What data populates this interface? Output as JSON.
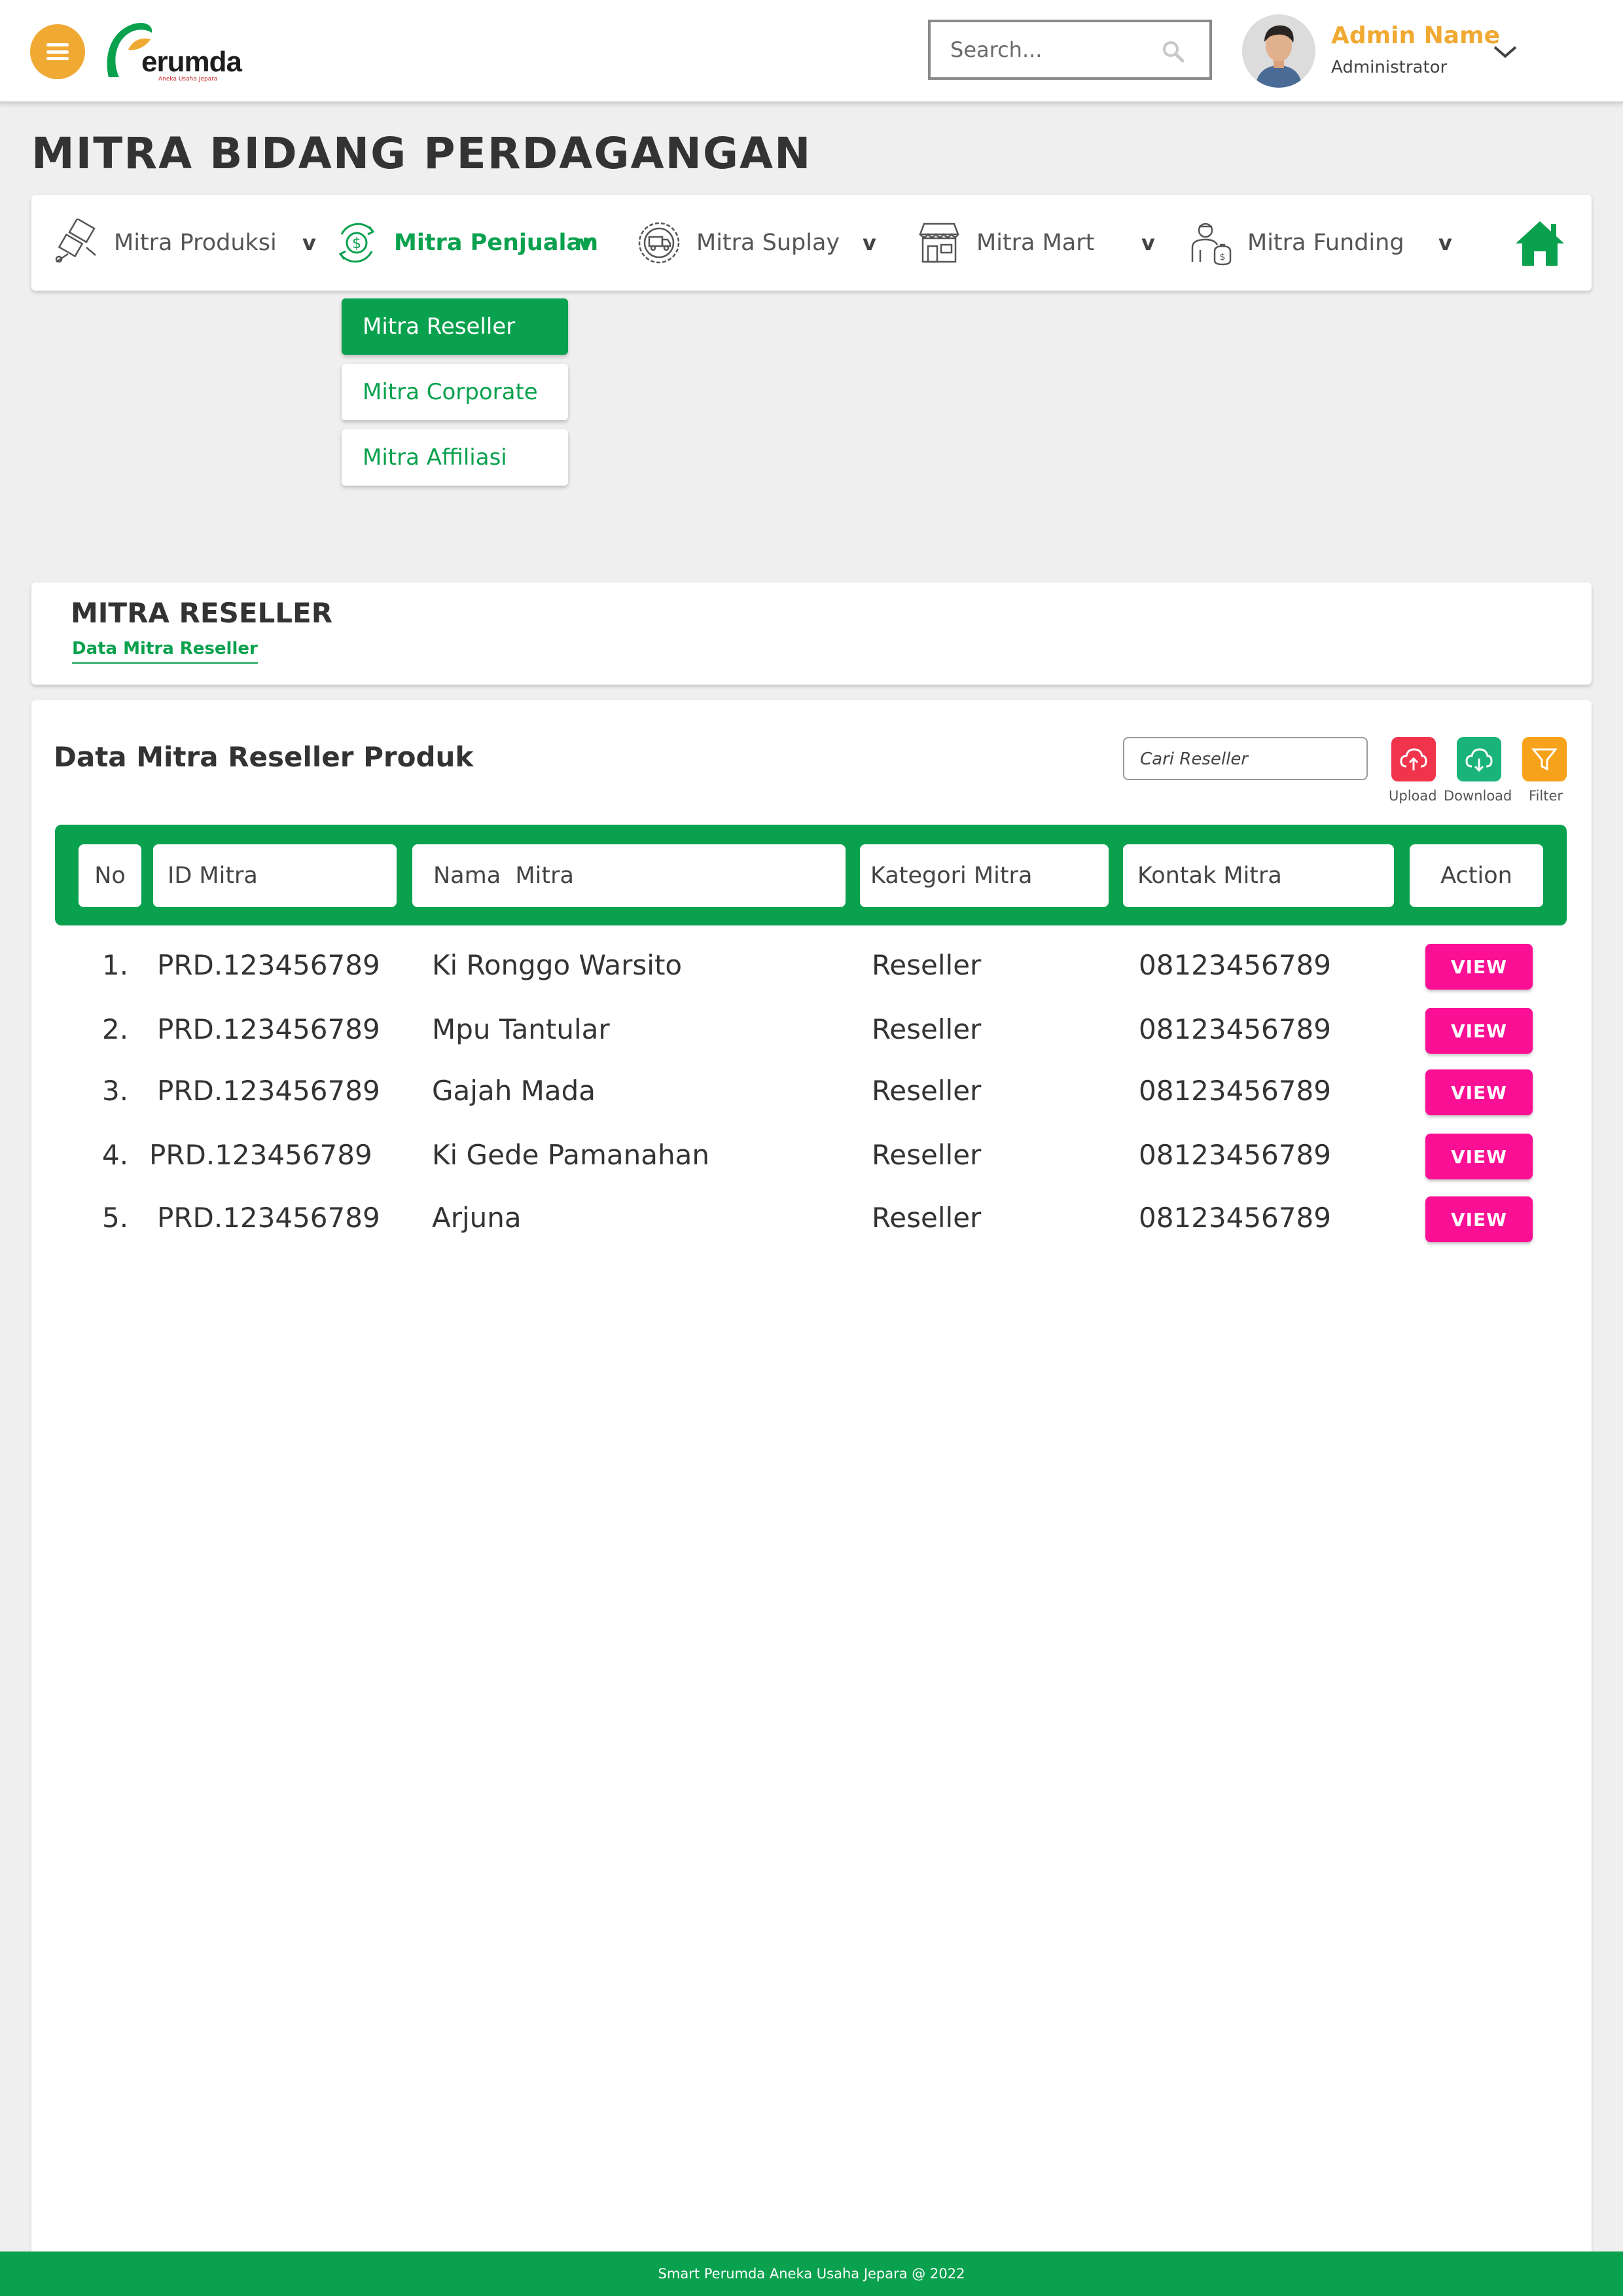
{
  "header": {
    "logo_text": "erumda",
    "logo_subtext": "Aneka Usaha Jepara",
    "search_placeholder": "Search...",
    "user": {
      "name": "Admin Name",
      "role": "Administrator"
    }
  },
  "page_title": "MITRA BIDANG PERDAGANGAN",
  "categories": [
    {
      "label": "Mitra Produksi",
      "caret": "v",
      "icon": "production-icon",
      "active": false
    },
    {
      "label": "Mitra Penjualan",
      "caret": "v",
      "icon": "money-cycle-icon",
      "active": true
    },
    {
      "label": "Mitra Suplay",
      "caret": "v",
      "icon": "supply-truck-icon",
      "active": false
    },
    {
      "label": "Mitra Mart",
      "caret": "v",
      "icon": "store-icon",
      "active": false
    },
    {
      "label": "Mitra Funding",
      "caret": "v",
      "icon": "investor-icon",
      "active": false
    }
  ],
  "dropdown": [
    {
      "label": "Mitra Reseller",
      "active": true
    },
    {
      "label": "Mitra Corporate",
      "active": false
    },
    {
      "label": "Mitra Affiliasi",
      "active": false
    }
  ],
  "section": {
    "title": "MITRA RESELLER",
    "breadcrumb": "Data Mitra Reseller"
  },
  "main": {
    "title": "Data Mitra Reseller Produk",
    "search_placeholder": "Cari Reseller",
    "tools": [
      {
        "label": "Upload",
        "icon": "upload-cloud-icon",
        "color": "#f0344c"
      },
      {
        "label": "Download",
        "icon": "download-cloud-icon",
        "color": "#1ab47a"
      },
      {
        "label": "Filter",
        "icon": "filter-icon",
        "color": "#f6a21a"
      }
    ],
    "columns": [
      "No",
      "ID Mitra",
      "Nama  Mitra",
      "Kategori Mitra",
      "Kontak Mitra",
      "Action"
    ],
    "rows": [
      {
        "no": "1.",
        "id": "PRD.123456789",
        "name": "Ki Ronggo Warsito",
        "category": "Reseller",
        "contact": "08123456789",
        "action": "VIEW"
      },
      {
        "no": "2.",
        "id": "PRD.123456789",
        "name": "Mpu Tantular",
        "category": "Reseller",
        "contact": "08123456789",
        "action": "VIEW"
      },
      {
        "no": "3.",
        "id": "PRD.123456789",
        "name": "Gajah Mada",
        "category": "Reseller",
        "contact": "08123456789",
        "action": "VIEW"
      },
      {
        "no": "4.",
        "id": "PRD.123456789",
        "name": "Ki Gede Pamanahan",
        "category": "Reseller",
        "contact": "08123456789",
        "action": "VIEW"
      },
      {
        "no": "5.",
        "id": "PRD.123456789",
        "name": "Arjuna",
        "category": "Reseller",
        "contact": "08123456789",
        "action": "VIEW"
      }
    ]
  },
  "colors": {
    "brand_green": "#0aa14e",
    "accent_orange": "#f0a932",
    "view_pink": "#fb0f94"
  },
  "footer": "Smart Perumda Aneka Usaha Jepara @ 2022"
}
